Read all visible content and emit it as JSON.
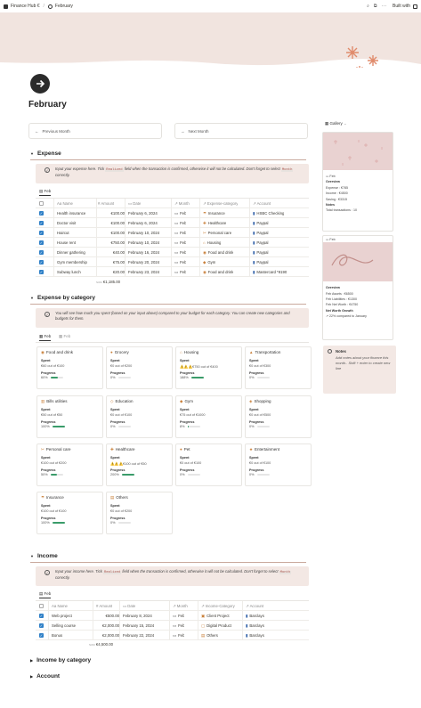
{
  "topbar": {
    "breadcrumb_parent": "Finance Hub €",
    "breadcrumb_page": "February",
    "built_with": "Built with"
  },
  "page": {
    "title": "February"
  },
  "nav": {
    "prev": "Previous Month",
    "next": "Next Month"
  },
  "gallery": {
    "label": "Gallery",
    "card1": {
      "name": "Feb",
      "section": "Overview",
      "lines": [
        "Expense : €785",
        "Income : €4500",
        "Saving : €3315"
      ],
      "notes_label": "Notes",
      "total": "Total transactions : 10"
    },
    "card2": {
      "name": "Feb",
      "section": "Overview",
      "lines": [
        "Feb Assets : €6500",
        "Feb Liabilities : €1300",
        "Feb Net Worth : €4750"
      ],
      "growth_label": "Net Worth Growth",
      "growth": "22% compared to January"
    },
    "notes": {
      "title": "Notes",
      "text": "Add notes about your finance this month.. Shift + enter to create new line"
    }
  },
  "expense": {
    "title": "Expense",
    "callout_pre": "Input your expense here. Tick ",
    "callout_code1": "Realized",
    "callout_mid": " field when the transaction is confirmed, otherwise it will not be calculated. Don't forget to select ",
    "callout_code2": "Month",
    "callout_post": " correctly.",
    "tab": "Feb",
    "headers": [
      "Name",
      "Amount",
      "Date",
      "Month",
      "Expense-category",
      "Account"
    ],
    "rows": [
      {
        "name": "Health insurance",
        "amount": "€100.00",
        "date": "February 6, 2024",
        "month": "Feb",
        "category": "Insurance",
        "account": "HSBC Checking"
      },
      {
        "name": "Doctor visit",
        "amount": "€100.00",
        "date": "February 6, 2024",
        "month": "Feb",
        "category": "Healthcare",
        "account": "Paypal"
      },
      {
        "name": "Haircut",
        "amount": "€100.00",
        "date": "February 10, 2024",
        "month": "Feb",
        "category": "Personal care",
        "account": "Paypal"
      },
      {
        "name": "House rent",
        "amount": "€750.00",
        "date": "February 10, 2024",
        "month": "Feb",
        "category": "Housing",
        "account": "Paypal"
      },
      {
        "name": "Dinner gathering",
        "amount": "€40.00",
        "date": "February 16, 2024",
        "month": "Feb",
        "category": "Food and drink",
        "account": "Paypal"
      },
      {
        "name": "Gym membership",
        "amount": "€75.00",
        "date": "February 20, 2024",
        "month": "Feb",
        "category": "Gym",
        "account": "Paypal"
      },
      {
        "name": "Subway lunch",
        "amount": "€20.00",
        "date": "February 23, 2024",
        "month": "Feb",
        "category": "Food and drink",
        "account": "Mastercard *9190"
      }
    ],
    "sum_label": "SUM",
    "sum": "€1,185.00"
  },
  "by_category": {
    "title": "Expense by category",
    "callout": "You will see how much you spent (based on your input above) compared to your budget for each category. You can create new categories and budgets for them.",
    "tab_active": "Feb",
    "tab_inactive": "Feb",
    "spent_label": "Spent",
    "progress_label": "Progress",
    "cards": [
      {
        "name": "Food and drink",
        "spent": "€60 out of €100",
        "progress": "60%",
        "pct": 0.6
      },
      {
        "name": "Grocery",
        "spent": "€0 out of €200",
        "progress": "0%",
        "pct": 0
      },
      {
        "name": "Housing",
        "spent": "⚠️⚠️⚠️€750 out of €400",
        "progress": "188%",
        "pct": 1
      },
      {
        "name": "Transportation",
        "spent": "€0 out of €300",
        "progress": "0%",
        "pct": 0
      },
      {
        "name": "Bills utilities",
        "spent": "€50 out of €50",
        "progress": "100%",
        "pct": 1
      },
      {
        "name": "Education",
        "spent": "€0 out of €100",
        "progress": "0%",
        "pct": 0
      },
      {
        "name": "Gym",
        "spent": "€75 out of €1000",
        "progress": "8%",
        "pct": 0.08
      },
      {
        "name": "Shopping",
        "spent": "€0 out of €500",
        "progress": "0%",
        "pct": 0
      },
      {
        "name": "Personal care",
        "spent": "€100 out of €200",
        "progress": "50%",
        "pct": 0.5
      },
      {
        "name": "Healthcare",
        "spent": "⚠️⚠️⚠️€100 out of €50",
        "progress": "200%",
        "pct": 1
      },
      {
        "name": "Pet",
        "spent": "€0 out of €100",
        "progress": "0%",
        "pct": 0
      },
      {
        "name": "Entertainment",
        "spent": "€0 out of €100",
        "progress": "0%",
        "pct": 0
      },
      {
        "name": "Insurance",
        "spent": "€100 out of €100",
        "progress": "100%",
        "pct": 1
      },
      {
        "name": "Others",
        "spent": "€0 out of €200",
        "progress": "0%",
        "pct": 0
      }
    ]
  },
  "income": {
    "title": "Income",
    "callout_pre": "Input your income here. Tick ",
    "callout_code1": "Realized",
    "callout_mid": " field when the transaction is confirmed, otherwise it will not be calculated. Don't forget to select ",
    "callout_code2": "Month",
    "callout_post": " correctly.",
    "tab": "Feb",
    "headers": [
      "Name",
      "Amount",
      "Date",
      "Month",
      "Income-Category",
      "Account"
    ],
    "rows": [
      {
        "name": "Web project",
        "amount": "€500.00",
        "date": "February 8, 2024",
        "month": "Feb",
        "category": "Client Project",
        "account": "Barclays"
      },
      {
        "name": "Selling course",
        "amount": "€2,000.00",
        "date": "February 15, 2024",
        "month": "Feb",
        "category": "Digital Product",
        "account": "Barclays"
      },
      {
        "name": "Bonus",
        "amount": "€2,000.00",
        "date": "February 22, 2024",
        "month": "Feb",
        "category": "Others",
        "account": "Barclays"
      }
    ],
    "sum_label": "SUM",
    "sum": "€4,500.00"
  },
  "collapsed": {
    "income_by_category": "Income by category",
    "account": "Account"
  }
}
